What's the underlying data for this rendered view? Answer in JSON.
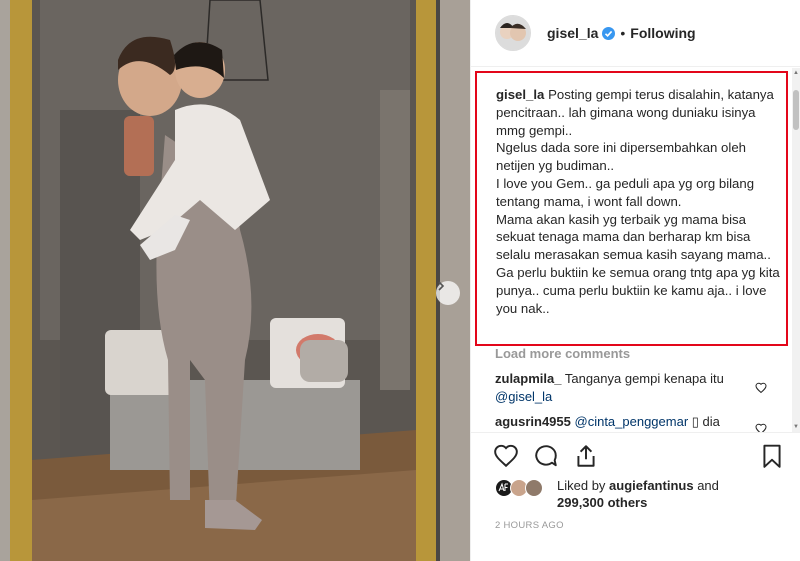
{
  "post": {
    "username": "gisel_la",
    "follow_status": "Following",
    "separator": "•"
  },
  "caption": {
    "username": "gisel_la",
    "text": "Posting gempi terus disalahin, katanya pencitraan.. lah gimana wong duniaku isinya mmg gempi..\nNgelus dada sore ini dipersembahkan oleh netijen yg budiman..\nI love you Gem.. ga peduli apa yg org bilang tentang mama, i wont fall down.\nMama akan kasih yg terbaik yg mama bisa sekuat tenaga mama dan berharap km bisa selalu merasakan semua kasih sayang mama..\nGa perlu buktiin ke semua orang tntg apa yg kita punya.. cuma perlu buktiin ke kamu aja.. i love you nak..",
    "highlight_color": "#e3061a"
  },
  "load_more": "Load more comments",
  "comments": [
    {
      "username": "zulapmila_",
      "text": "Tanganya gempi kenapa itu",
      "mention": "@gisel_la"
    },
    {
      "username": "agusrin4955",
      "mention": "@cinta_penggemar",
      "text": "▯ dia"
    }
  ],
  "likes": {
    "prefix": "Liked by",
    "top_liker": "augiefantinus",
    "conjunction": "and",
    "others": "299,300 others"
  },
  "timestamp": "2 HOURS AGO",
  "icons": {
    "verified": "verified-badge-icon",
    "like": "heart-icon",
    "comment": "comment-bubble-icon",
    "share": "share-arrow-icon",
    "save": "bookmark-icon",
    "next": "chevron-right-icon"
  },
  "colors": {
    "verified_blue": "#3897f0",
    "mention_blue": "#003569",
    "muted": "#999999"
  }
}
